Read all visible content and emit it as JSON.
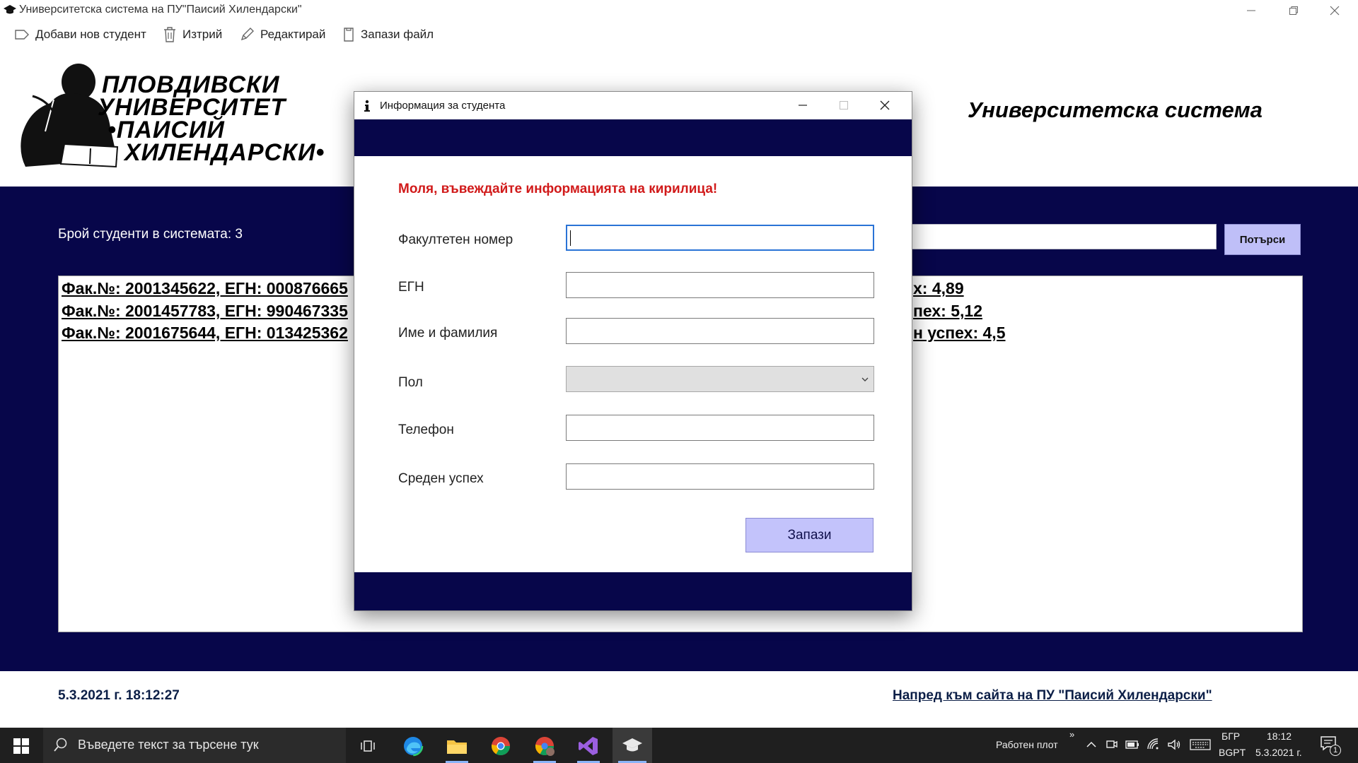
{
  "window": {
    "title": "Университетска система на ПУ\"Паисий Хилендарски\"",
    "icon": "graduation-cap-icon"
  },
  "toolbar": {
    "add_student": "Добави нов студент",
    "delete": "Изтрий",
    "edit": "Редактирай",
    "save_file": "Запази файл"
  },
  "header": {
    "logo_lines": [
      "ПЛОВДИВСКИ",
      "УНИВЕРСИТЕТ",
      "•ПАИСИЙ",
      "ХИЛЕНДАРСКИ•"
    ],
    "system_title": "Университетска система"
  },
  "main": {
    "student_count": "Брой студенти в системата: 3",
    "search_button": "Потърси",
    "search_value": "",
    "students_left": [
      "Фак.№: 2001345622, ЕГН: 000876665",
      "Фак.№: 2001457783, ЕГН: 990467335",
      "Фак.№: 2001675644, ЕГН: 013425362"
    ],
    "students_right": [
      "х: 4,89",
      "пех: 5,12",
      "н успех: 4,5"
    ]
  },
  "footer": {
    "datetime": "5.3.2021 г. 18:12:27",
    "site_link": "Напред към сайта на ПУ \"Паисий Хилендарски\""
  },
  "dialog": {
    "title": "Информация за студента",
    "warning": "Моля, въвеждайте информацията на кирилица!",
    "fields": {
      "faculty_number": "Факултетен номер",
      "egn": "ЕГН",
      "full_name": "Име и фамилия",
      "gender": "Пол",
      "phone": "Телефон",
      "gpa": "Среден успех"
    },
    "values": {
      "faculty_number": "",
      "egn": "",
      "full_name": "",
      "gender": "",
      "phone": "",
      "gpa": ""
    },
    "save_button": "Запази"
  },
  "taskbar": {
    "search_placeholder": "Въведете текст за търсене тук",
    "desktop_label": "Работен плот",
    "language": "БГР",
    "keyboard_layout": "BGPT",
    "time": "18:12",
    "date": "5.3.2021 г.",
    "notifications_count": "1"
  },
  "colors": {
    "navy": "#07064a",
    "button_lavender": "#c3c3fb",
    "warning_red": "#d11a1a",
    "footer_text": "#0c1f47",
    "focus_blue": "#2a73d6"
  }
}
